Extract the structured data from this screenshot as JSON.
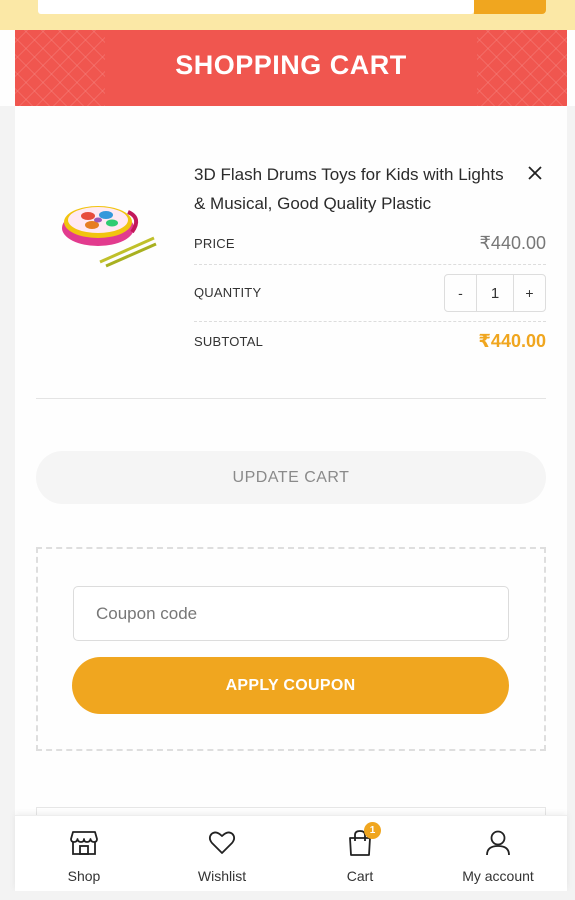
{
  "header": {
    "title": "SHOPPING CART"
  },
  "cart": {
    "product_name": "3D Flash Drums Toys for Kids with Lights & Musical, Good Quality Plastic",
    "price_label": "PRICE",
    "price_value": "₹440.00",
    "quantity_label": "QUANTITY",
    "quantity_value": "1",
    "decrease_label": "-",
    "increase_label": "+",
    "subtotal_label": "SUBTOTAL",
    "subtotal_value": "₹440.00",
    "update_cart_label": "UPDATE CART"
  },
  "coupon": {
    "placeholder": "Coupon code",
    "apply_label": "APPLY COUPON"
  },
  "bottom_nav": {
    "shop": "Shop",
    "wishlist": "Wishlist",
    "cart": "Cart",
    "cart_count": "1",
    "account": "My account"
  },
  "colors": {
    "accent": "#f0a61f",
    "banner": "#f0564f",
    "top_strip": "#fbe8a6"
  },
  "icons": {
    "remove": "close-icon",
    "shop": "store-icon",
    "wishlist": "heart-icon",
    "cart": "shopping-bag-icon",
    "account": "user-icon"
  }
}
